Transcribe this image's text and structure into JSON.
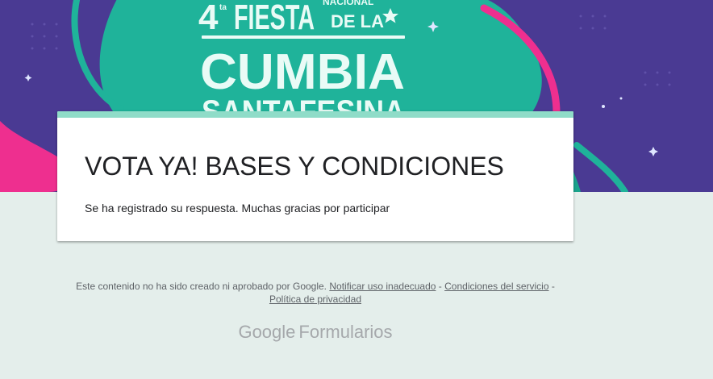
{
  "banner": {
    "number": "4",
    "superscript": "ta",
    "line1_word": "FIESTA",
    "line1_small": "NACIONAL",
    "line1_tail": "DE LA",
    "line2": "CUMBIA",
    "line3": "SANTAFESINA",
    "colors": {
      "background": "#4a3a93",
      "teal": "#1fb39a",
      "pink": "#ee2f8f",
      "lettering": "#e9fbf6"
    }
  },
  "card": {
    "title": "VOTA YA! BASES Y CONDICIONES",
    "message": "Se ha registrado su respuesta. Muchas gracias por participar",
    "accent_color": "#8fdcc8"
  },
  "footer": {
    "disclaimer": "Este contenido no ha sido creado ni aprobado por Google.",
    "report_link": "Notificar uso inadecuado",
    "separator1": " - ",
    "terms_link": "Condiciones del servicio",
    "separator2": " -",
    "privacy_link": "Política de privacidad"
  },
  "branding": {
    "google": "Google",
    "product": "Formularios"
  }
}
